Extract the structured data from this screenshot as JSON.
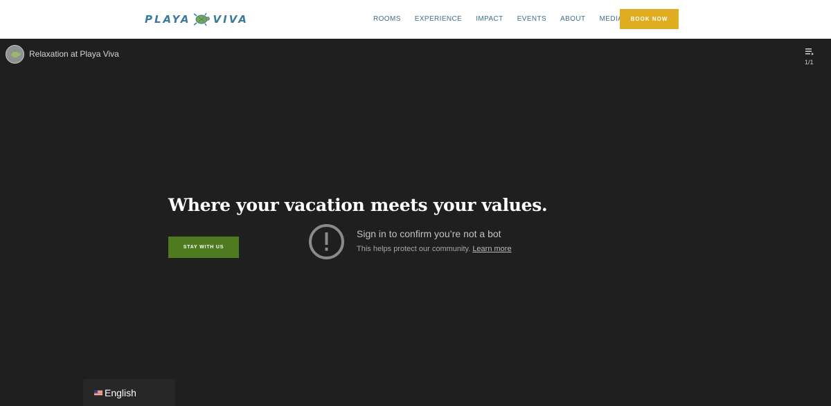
{
  "header": {
    "logo_left": "PLAYA",
    "logo_right": "VIVA",
    "nav": [
      "ROOMS",
      "EXPERIENCE",
      "IMPACT",
      "EVENTS",
      "ABOUT",
      "MEDIA"
    ],
    "book_label": "BOOK NOW"
  },
  "video": {
    "title": "Relaxation at Playa Viva",
    "playlist_count": "1/1",
    "headline": "Where your vacation meets your values.",
    "cta_label": "STAY WITH US",
    "bot_title": "Sign in to confirm you’re not a bot",
    "bot_sub": "This helps protect our community.",
    "learn_more": "Learn more"
  },
  "language": {
    "label": "English",
    "flag_icon": "us-flag-icon"
  },
  "colors": {
    "accent": "#e0ad21",
    "cta": "#4e7b1f",
    "nav": "#3a6f8c",
    "video_bg": "#1f1f1f"
  }
}
